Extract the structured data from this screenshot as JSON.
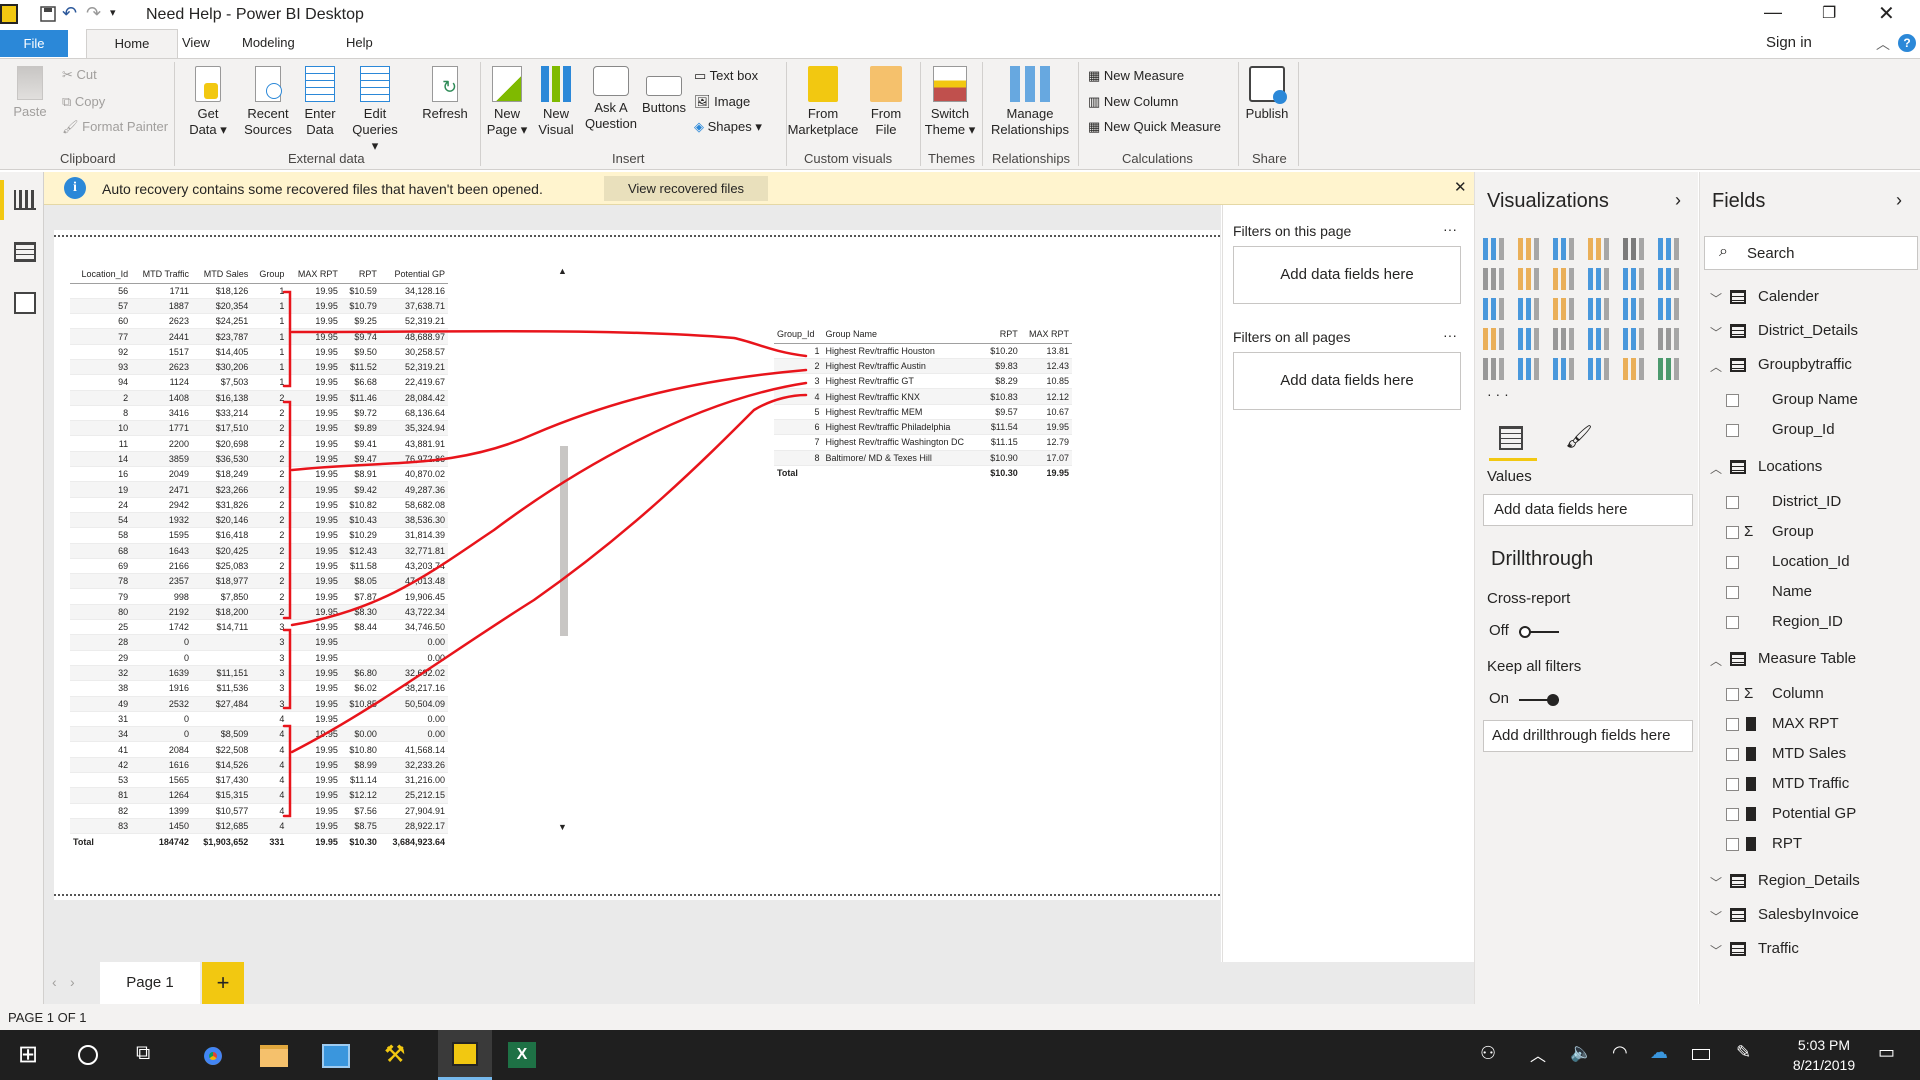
{
  "window": {
    "title": "Need Help - Power BI Desktop"
  },
  "tabs": {
    "file": "File",
    "home": "Home",
    "view": "View",
    "modeling": "Modeling",
    "help": "Help",
    "sign_in": "Sign in"
  },
  "ribbon": {
    "clipboard": {
      "paste": "Paste",
      "cut": "Cut",
      "copy": "Copy",
      "format_painter": "Format Painter",
      "group": "Clipboard"
    },
    "external": {
      "get_data": "Get Data",
      "recent": "Recent Sources",
      "enter": "Enter Data",
      "edit": "Edit Queries",
      "refresh": "Refresh",
      "group": "External data"
    },
    "insert": {
      "new_page": "New Page",
      "new_visual": "New Visual",
      "ask": "Ask A Question",
      "buttons": "Buttons",
      "text_box": "Text box",
      "image": "Image",
      "shapes": "Shapes",
      "group": "Insert"
    },
    "custom": {
      "marketplace": "From Marketplace",
      "file": "From File",
      "group": "Custom visuals"
    },
    "themes": {
      "switch": "Switch Theme",
      "group": "Themes"
    },
    "rel": {
      "manage": "Manage Relationships",
      "group": "Relationships"
    },
    "calc": {
      "new_measure": "New Measure",
      "new_column": "New Column",
      "new_quick": "New Quick Measure",
      "group": "Calculations"
    },
    "share": {
      "publish": "Publish",
      "group": "Share"
    }
  },
  "infobar": {
    "message": "Auto recovery contains some recovered files that haven't been opened.",
    "button": "View recovered files"
  },
  "table1": {
    "headers": [
      "Location_Id",
      "MTD Traffic",
      "MTD Sales",
      "Group",
      "MAX RPT",
      "RPT",
      "Potential GP"
    ],
    "rows": [
      [
        "56",
        "1711",
        "$18,126",
        "1",
        "19.95",
        "$10.59",
        "34,128.16"
      ],
      [
        "57",
        "1887",
        "$20,354",
        "1",
        "19.95",
        "$10.79",
        "37,638.71"
      ],
      [
        "60",
        "2623",
        "$24,251",
        "1",
        "19.95",
        "$9.25",
        "52,319.21"
      ],
      [
        "77",
        "2441",
        "$23,787",
        "1",
        "19.95",
        "$9.74",
        "48,688.97"
      ],
      [
        "92",
        "1517",
        "$14,405",
        "1",
        "19.95",
        "$9.50",
        "30,258.57"
      ],
      [
        "93",
        "2623",
        "$30,206",
        "1",
        "19.95",
        "$11.52",
        "52,319.21"
      ],
      [
        "94",
        "1124",
        "$7,503",
        "1",
        "19.95",
        "$6.68",
        "22,419.67"
      ],
      [
        "2",
        "1408",
        "$16,138",
        "2",
        "19.95",
        "$11.46",
        "28,084.42"
      ],
      [
        "8",
        "3416",
        "$33,214",
        "2",
        "19.95",
        "$9.72",
        "68,136.64"
      ],
      [
        "10",
        "1771",
        "$17,510",
        "2",
        "19.95",
        "$9.89",
        "35,324.94"
      ],
      [
        "11",
        "2200",
        "$20,698",
        "2",
        "19.95",
        "$9.41",
        "43,881.91"
      ],
      [
        "14",
        "3859",
        "$36,530",
        "2",
        "19.95",
        "$9.47",
        "76,972.86"
      ],
      [
        "16",
        "2049",
        "$18,249",
        "2",
        "19.95",
        "$8.91",
        "40,870.02"
      ],
      [
        "19",
        "2471",
        "$23,266",
        "2",
        "19.95",
        "$9.42",
        "49,287.36"
      ],
      [
        "24",
        "2942",
        "$31,826",
        "2",
        "19.95",
        "$10.82",
        "58,682.08"
      ],
      [
        "54",
        "1932",
        "$20,146",
        "2",
        "19.95",
        "$10.43",
        "38,536.30"
      ],
      [
        "58",
        "1595",
        "$16,418",
        "2",
        "19.95",
        "$10.29",
        "31,814.39"
      ],
      [
        "68",
        "1643",
        "$20,425",
        "2",
        "19.95",
        "$12.43",
        "32,771.81"
      ],
      [
        "69",
        "2166",
        "$25,083",
        "2",
        "19.95",
        "$11.58",
        "43,203.74"
      ],
      [
        "78",
        "2357",
        "$18,977",
        "2",
        "19.95",
        "$8.05",
        "47,013.48"
      ],
      [
        "79",
        "998",
        "$7,850",
        "2",
        "19.95",
        "$7.87",
        "19,906.45"
      ],
      [
        "80",
        "2192",
        "$18,200",
        "2",
        "19.95",
        "$8.30",
        "43,722.34"
      ],
      [
        "25",
        "1742",
        "$14,711",
        "3",
        "19.95",
        "$8.44",
        "34,746.50"
      ],
      [
        "28",
        "0",
        "",
        "3",
        "19.95",
        "",
        "0.00"
      ],
      [
        "29",
        "0",
        "",
        "3",
        "19.95",
        "",
        "0.00"
      ],
      [
        "32",
        "1639",
        "$11,151",
        "3",
        "19.95",
        "$6.80",
        "32,692.02"
      ],
      [
        "38",
        "1916",
        "$11,536",
        "3",
        "19.95",
        "$6.02",
        "38,217.16"
      ],
      [
        "49",
        "2532",
        "$27,484",
        "3",
        "19.95",
        "$10.85",
        "50,504.09"
      ],
      [
        "31",
        "0",
        "",
        "4",
        "19.95",
        "",
        "0.00"
      ],
      [
        "34",
        "0",
        "$8,509",
        "4",
        "19.95",
        "$0.00",
        "0.00"
      ],
      [
        "41",
        "2084",
        "$22,508",
        "4",
        "19.95",
        "$10.80",
        "41,568.14"
      ],
      [
        "42",
        "1616",
        "$14,526",
        "4",
        "19.95",
        "$8.99",
        "32,233.26"
      ],
      [
        "53",
        "1565",
        "$17,430",
        "4",
        "19.95",
        "$11.14",
        "31,216.00"
      ],
      [
        "81",
        "1264",
        "$15,315",
        "4",
        "19.95",
        "$12.12",
        "25,212.15"
      ],
      [
        "82",
        "1399",
        "$10,577",
        "4",
        "19.95",
        "$7.56",
        "27,904.91"
      ],
      [
        "83",
        "1450",
        "$12,685",
        "4",
        "19.95",
        "$8.75",
        "28,922.17"
      ]
    ],
    "total": [
      "Total",
      "184742",
      "$1,903,652",
      "331",
      "19.95",
      "$10.30",
      "3,684,923.64"
    ]
  },
  "table2": {
    "headers": [
      "Group_Id",
      "Group Name",
      "RPT",
      "MAX RPT"
    ],
    "rows": [
      [
        "1",
        "Highest Rev/traffic Houston",
        "$10.20",
        "13.81"
      ],
      [
        "2",
        "Highest Rev/traffic Austin",
        "$9.83",
        "12.43"
      ],
      [
        "3",
        "Highest Rev/traffic GT",
        "$8.29",
        "10.85"
      ],
      [
        "4",
        "Highest Rev/traffic KNX",
        "$10.83",
        "12.12"
      ],
      [
        "5",
        "Highest Rev/traffic MEM",
        "$9.57",
        "10.67"
      ],
      [
        "6",
        "Highest Rev/traffic Philadelphia",
        "$11.54",
        "19.95"
      ],
      [
        "7",
        "Highest Rev/traffic Washington DC",
        "$11.15",
        "12.79"
      ],
      [
        "8",
        "Baltimore/ MD & Texes Hill",
        "$10.90",
        "17.07"
      ]
    ],
    "total": [
      "Total",
      "",
      "$10.30",
      "19.95"
    ]
  },
  "filters": {
    "on_page": "Filters on this page",
    "on_all": "Filters on all pages",
    "add": "Add data fields here",
    "more": "···"
  },
  "viz": {
    "title": "Visualizations",
    "values": "Values",
    "add_values": "Add data fields here",
    "drillthrough": "Drillthrough",
    "cross_report": "Cross-report",
    "off": "Off",
    "keep_all": "Keep all filters",
    "on": "On",
    "add_drill": "Add drillthrough fields here",
    "more": "· · ·"
  },
  "fields": {
    "title": "Fields",
    "search": "Search",
    "tables": [
      {
        "name": "Calender",
        "expanded": false,
        "items": []
      },
      {
        "name": "District_Details",
        "expanded": false,
        "items": []
      },
      {
        "name": "Groupbytraffic",
        "expanded": true,
        "items": [
          {
            "name": "Group Name",
            "icon": "none"
          },
          {
            "name": "Group_Id",
            "icon": "none"
          }
        ]
      },
      {
        "name": "Locations",
        "expanded": true,
        "items": [
          {
            "name": "District_ID",
            "icon": "none"
          },
          {
            "name": "Group",
            "icon": "sigma"
          },
          {
            "name": "Location_Id",
            "icon": "none"
          },
          {
            "name": "Name",
            "icon": "none"
          },
          {
            "name": "Region_ID",
            "icon": "none"
          }
        ]
      },
      {
        "name": "Measure Table",
        "expanded": true,
        "items": [
          {
            "name": "Column",
            "icon": "sigma"
          },
          {
            "name": "MAX RPT",
            "icon": "calc"
          },
          {
            "name": "MTD Sales",
            "icon": "calc"
          },
          {
            "name": "MTD Traffic",
            "icon": "calc"
          },
          {
            "name": "Potential GP",
            "icon": "calc"
          },
          {
            "name": "RPT",
            "icon": "calc"
          }
        ]
      },
      {
        "name": "Region_Details",
        "expanded": false,
        "items": []
      },
      {
        "name": "SalesbyInvoice",
        "expanded": false,
        "items": []
      },
      {
        "name": "Traffic",
        "expanded": false,
        "items": []
      }
    ]
  },
  "pages": {
    "page1": "Page 1",
    "add": "+"
  },
  "status": {
    "text": "PAGE 1 OF 1"
  },
  "taskbar": {
    "time": "5:03 PM",
    "date": "8/21/2019"
  },
  "colors": {
    "accent": "#f2c811",
    "file_tab": "#2b88d8",
    "annotation": "#e8141b",
    "info": "#2b88d8"
  }
}
